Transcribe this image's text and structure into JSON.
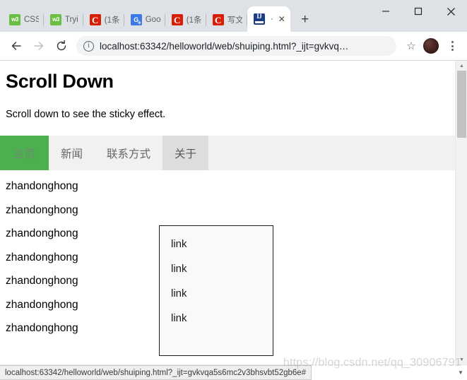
{
  "browser": {
    "tabs": [
      {
        "label": "CSS",
        "favicon": "w3schools-icon",
        "favicon_text": "w3",
        "active": false
      },
      {
        "label": "Tryi",
        "favicon": "w3schools-icon",
        "favicon_text": "w3",
        "active": false
      },
      {
        "label": "(1条",
        "favicon": "csdn-icon",
        "favicon_text": "C",
        "active": false
      },
      {
        "label": "Goo",
        "favicon": "google-translate-icon",
        "favicon_text": "G",
        "active": false
      },
      {
        "label": "(1条",
        "favicon": "csdn-icon",
        "favicon_text": "C",
        "active": false
      },
      {
        "label": "写文",
        "favicon": "csdn-icon",
        "favicon_text": "C",
        "active": false
      },
      {
        "label": "",
        "favicon": "intellij-idea-icon",
        "favicon_text": "IJ",
        "active": true
      }
    ],
    "new_tab_label": "+",
    "window_controls": {
      "minimize": "minimize-icon",
      "maximize": "maximize-icon",
      "close": "close-icon"
    },
    "toolbar": {
      "back_label": "back-icon",
      "forward_label": "forward-icon",
      "reload_label": "reload-icon",
      "info_label": "i",
      "url_display": "localhost:63342/helloworld/web/shuiping.html?_ijt=gvkvq…",
      "bookmark_label": "☆",
      "profile_label": "profile-avatar",
      "menu_label": "chrome-menu"
    }
  },
  "page": {
    "title": "Scroll Down",
    "subtitle": "Scroll down to see the sticky effect.",
    "nav": {
      "items": [
        {
          "label": "主页",
          "state": "active"
        },
        {
          "label": "新闻",
          "state": "default"
        },
        {
          "label": "联系方式",
          "state": "default"
        },
        {
          "label": "关于",
          "state": "hovered"
        }
      ],
      "active_color": "#4CAF50",
      "hover_color": "#dddddd",
      "bar_color": "#f1f1f1"
    },
    "dropdown": {
      "open": true,
      "items": [
        "link",
        "link",
        "link",
        "link"
      ]
    },
    "body_lines": [
      "zhandonghong",
      "zhandonghong",
      "zhandonghong",
      "zhandonghong",
      "zhandonghong",
      "zhandonghong",
      "zhandonghong"
    ]
  },
  "status_bar": {
    "url": "localhost:63342/helloworld/web/shuiping.html?_ijt=gvkvqa5s6mc2v3bhsvbt52gb6e#"
  },
  "watermark": {
    "text": "https://blog.csdn.net/qq_30906791"
  }
}
